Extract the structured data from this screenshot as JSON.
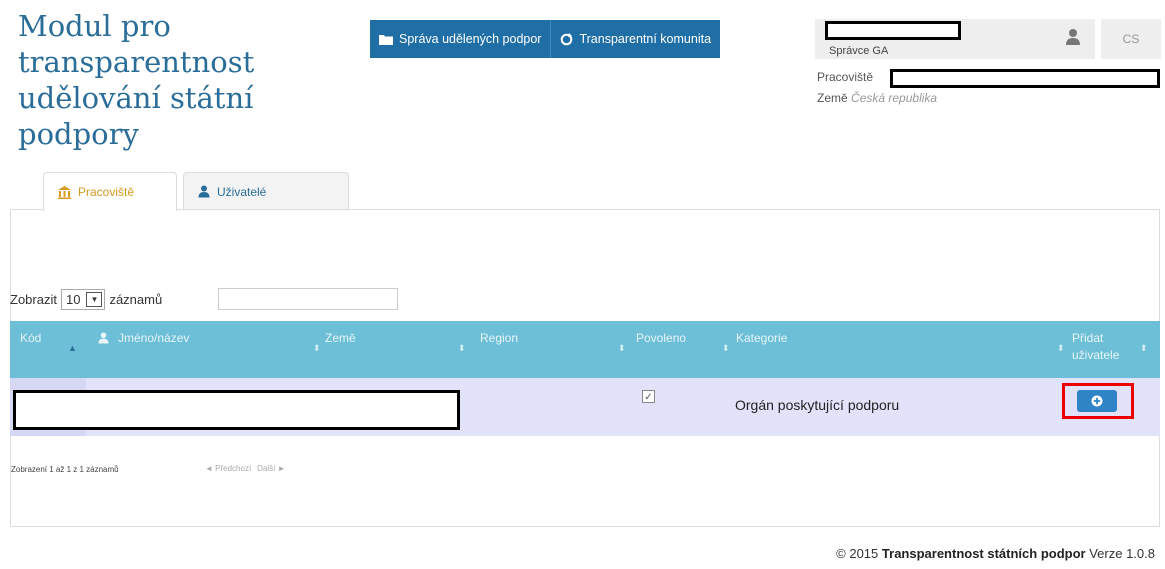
{
  "app": {
    "title": "Modul pro transparentnost udělování státní podpory"
  },
  "topnav": {
    "items": [
      {
        "label": "Správa udělených podpor",
        "icon": "folder-icon"
      },
      {
        "label": "Transparentní komunita",
        "icon": "refresh-icon"
      }
    ]
  },
  "user": {
    "role": "Správce GA",
    "lang": "CS",
    "workplace_label": "Pracoviště",
    "country_label": "Země",
    "country_value": "Česká republika"
  },
  "tabs": [
    {
      "label": "Pracoviště",
      "icon": "building-icon",
      "active": true
    },
    {
      "label": "Uživatelé",
      "icon": "user-icon",
      "active": false
    }
  ],
  "table_controls": {
    "show_label": "Zobrazit",
    "page_size": "10",
    "records_label": "záznamů"
  },
  "table": {
    "columns": [
      "Kód",
      "Jméno/název",
      "Země",
      "Region",
      "Povoleno",
      "Kategorie",
      "Přidat uživatele"
    ],
    "rows": [
      {
        "kod": "",
        "name": "",
        "zeme": "",
        "region": "",
        "povoleno": true,
        "kategorie": "Orgán poskytující podporu"
      }
    ],
    "info": "Zobrazení 1 až 1 z 1 záznamů",
    "prev_label": "Předchozí",
    "next_label": "Další"
  },
  "footer": {
    "copyright": "© 2015",
    "product": "Transparentnost státních podpor",
    "version": "Verze 1.0.8"
  },
  "colors": {
    "nav": "#1f6fa6",
    "header": "#6cbfd6",
    "row": "#e2e3fb",
    "title": "#2a6d99",
    "accent": "#d69a1f"
  }
}
